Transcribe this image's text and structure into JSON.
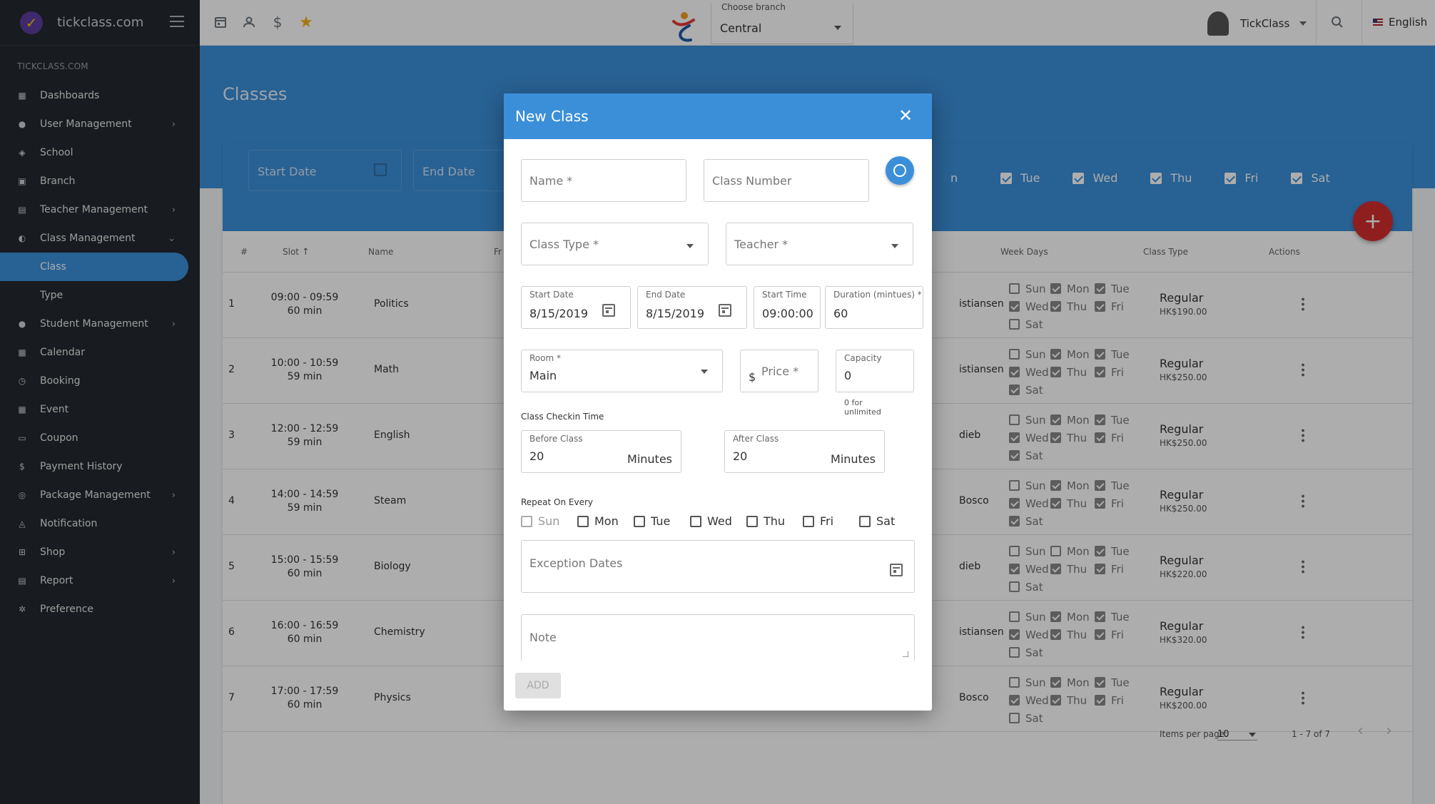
{
  "brand": {
    "name": "tickclass.com"
  },
  "sidebar": {
    "section_label": "TICKCLASS.COM",
    "items": [
      {
        "label": "Dashboards",
        "icon": "dashboard-icon",
        "has_children": false
      },
      {
        "label": "User Management",
        "icon": "user-icon",
        "has_children": true
      },
      {
        "label": "School",
        "icon": "school-icon",
        "has_children": false
      },
      {
        "label": "Branch",
        "icon": "branch-icon",
        "has_children": false
      },
      {
        "label": "Teacher Management",
        "icon": "teacher-icon",
        "has_children": true
      },
      {
        "label": "Class Management",
        "icon": "class-icon",
        "has_children": true,
        "expanded": true
      },
      {
        "label": "Class",
        "sub": true,
        "active": true
      },
      {
        "label": "Type",
        "sub": true
      },
      {
        "label": "Student Management",
        "icon": "student-icon",
        "has_children": true
      },
      {
        "label": "Calendar",
        "icon": "calendar-icon",
        "has_children": false
      },
      {
        "label": "Booking",
        "icon": "alarm-icon",
        "has_children": false
      },
      {
        "label": "Event",
        "icon": "event-icon",
        "has_children": false
      },
      {
        "label": "Coupon",
        "icon": "coupon-icon",
        "has_children": false
      },
      {
        "label": "Payment History",
        "icon": "dollar-icon",
        "has_children": false
      },
      {
        "label": "Package Management",
        "icon": "package-icon",
        "has_children": true
      },
      {
        "label": "Notification",
        "icon": "bell-icon",
        "has_children": false
      },
      {
        "label": "Shop",
        "icon": "cart-icon",
        "has_children": true
      },
      {
        "label": "Report",
        "icon": "report-icon",
        "has_children": true
      },
      {
        "label": "Preference",
        "icon": "gear-icon",
        "has_children": false
      }
    ]
  },
  "topbar": {
    "branch_label": "Choose branch",
    "branch_value": "Central",
    "user_name": "TickClass",
    "language": "English"
  },
  "page": {
    "title": "Classes"
  },
  "filters": {
    "start_date_placeholder": "Start Date",
    "end_date_placeholder": "End Date",
    "days": [
      "n",
      "Tue",
      "Wed",
      "Thu",
      "Fri",
      "Sat"
    ]
  },
  "table": {
    "headers": {
      "num": "#",
      "slot": "Slot",
      "name": "Name",
      "fr": "Fr",
      "week_days": "Week Days",
      "class_type": "Class Type",
      "actions": "Actions"
    },
    "rows": [
      {
        "num": "1",
        "slot_time": "09:00 - 09:59",
        "slot_dur": "60 min",
        "name": "Politics",
        "teacher": "istiansen",
        "mon": true,
        "type": "Regular",
        "price": "HK$190.00"
      },
      {
        "num": "2",
        "slot_time": "10:00 - 10:59",
        "slot_dur": "59 min",
        "name": "Math",
        "teacher": "istiansen",
        "mon": true,
        "type": "Regular",
        "price": "HK$250.00"
      },
      {
        "num": "3",
        "slot_time": "12:00 - 12:59",
        "slot_dur": "59 min",
        "name": "English",
        "teacher": "dieb",
        "mon": true,
        "type": "Regular",
        "price": "HK$250.00"
      },
      {
        "num": "4",
        "slot_time": "14:00 - 14:59",
        "slot_dur": "59 min",
        "name": "Steam",
        "teacher": "Bosco",
        "mon": true,
        "type": "Regular",
        "price": "HK$250.00"
      },
      {
        "num": "5",
        "slot_time": "15:00 - 15:59",
        "slot_dur": "60 min",
        "name": "Biology",
        "teacher": "dieb",
        "mon": false,
        "type": "Regular",
        "price": "HK$220.00"
      },
      {
        "num": "6",
        "slot_time": "16:00 - 16:59",
        "slot_dur": "60 min",
        "name": "Chemistry",
        "teacher": "istiansen",
        "mon": true,
        "type": "Regular",
        "price": "HK$320.00"
      },
      {
        "num": "7",
        "slot_time": "17:00 - 17:59",
        "slot_dur": "60 min",
        "name": "Physics",
        "teacher": "Bosco",
        "mon": true,
        "type": "Regular",
        "price": "HK$200.00"
      }
    ],
    "wd_labels": {
      "sun": "Sun",
      "mon": "Mon",
      "tue": "Tue",
      "wed": "Wed",
      "thu": "Thu",
      "fri": "Fri",
      "sat": "Sat"
    }
  },
  "pagination": {
    "items_per_page_label": "Items per page:",
    "items_per_page": "10",
    "range": "1 - 7 of 7"
  },
  "modal": {
    "title": "New Class",
    "name_ph": "Name *",
    "class_number_ph": "Class Number",
    "class_type_ph": "Class Type *",
    "teacher_ph": "Teacher *",
    "start_date_label": "Start Date",
    "start_date": "8/15/2019",
    "end_date_label": "End Date",
    "end_date": "8/15/2019",
    "start_time_label": "Start Time",
    "start_time": "09:00:00",
    "duration_label": "Duration (mintues) *",
    "duration": "60",
    "room_label": "Room *",
    "room": "Main",
    "currency": "$",
    "price_ph": "Price *",
    "capacity_label": "Capacity",
    "capacity": "0",
    "capacity_hint_1": "0 for",
    "capacity_hint_2": "unlimited",
    "checkin_label": "Class Checkin Time",
    "before_label": "Before Class",
    "before_value": "20",
    "after_label": "After Class",
    "after_value": "20",
    "minutes": "Minutes",
    "repeat_label": "Repeat On Every",
    "repeat_days": [
      "Sun",
      "Mon",
      "Tue",
      "Wed",
      "Thu",
      "Fri",
      "Sat"
    ],
    "exception_ph": "Exception Dates",
    "note_ph": "Note",
    "add_label": "ADD"
  },
  "colors": {
    "primary": "#3b8fd9",
    "sidebar": "#24292f",
    "fab": "#d32f2f"
  }
}
